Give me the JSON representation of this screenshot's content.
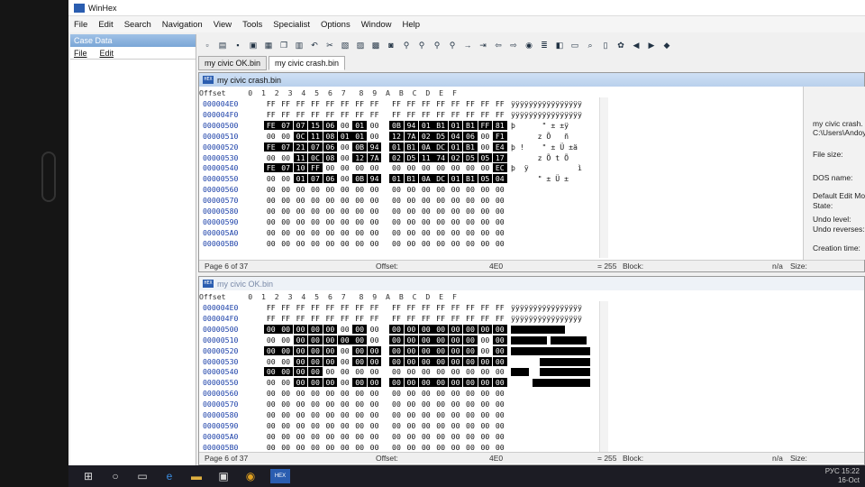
{
  "app": {
    "title": "WinHex"
  },
  "menu": [
    "File",
    "Edit",
    "Search",
    "Navigation",
    "View",
    "Tools",
    "Specialist",
    "Options",
    "Window",
    "Help"
  ],
  "left_pane": {
    "title": "Case Data",
    "menu": [
      "File",
      "Edit"
    ]
  },
  "tabs": [
    {
      "label": "my civic OK.bin"
    },
    {
      "label": "my civic crash.bin"
    }
  ],
  "hex_header": "Offset     0  1  2  3  4  5  6  7   8  9  A  B  C  D  E  F",
  "editor_top": {
    "title": "my civic crash.bin",
    "offsets": [
      "000004E0",
      "000004F0",
      "00000500",
      "00000510",
      "00000520",
      "00000530",
      "00000540",
      "00000550",
      "00000560",
      "00000570",
      "00000580",
      "00000590",
      "000005A0",
      "000005B0"
    ],
    "rows": [
      [
        "FF",
        "FF",
        "FF",
        "FF",
        "FF",
        "FF",
        "FF",
        "FF",
        "FF",
        "FF",
        "FF",
        "FF",
        "FF",
        "FF",
        "FF",
        "FF"
      ],
      [
        "FF",
        "FF",
        "FF",
        "FF",
        "FF",
        "FF",
        "FF",
        "FF",
        "FF",
        "FF",
        "FF",
        "FF",
        "FF",
        "FF",
        "FF",
        "FF"
      ],
      [
        "FE",
        "07",
        "07",
        "15",
        "06",
        "00",
        "01",
        "00",
        "0B",
        "94",
        "01",
        "B1",
        "01",
        "B1",
        "FF",
        "81"
      ],
      [
        "00",
        "00",
        "0C",
        "11",
        "08",
        "01",
        "01",
        "00",
        "12",
        "7A",
        "02",
        "D5",
        "04",
        "06",
        "00",
        "F1"
      ],
      [
        "FE",
        "07",
        "21",
        "07",
        "06",
        "00",
        "0B",
        "94",
        "01",
        "B1",
        "0A",
        "DC",
        "01",
        "B1",
        "00",
        "E4"
      ],
      [
        "00",
        "00",
        "11",
        "0C",
        "08",
        "00",
        "12",
        "7A",
        "02",
        "D5",
        "11",
        "74",
        "02",
        "D5",
        "05",
        "17"
      ],
      [
        "FE",
        "07",
        "10",
        "FF",
        "00",
        "00",
        "00",
        "00",
        "00",
        "00",
        "00",
        "00",
        "00",
        "00",
        "00",
        "EC"
      ],
      [
        "00",
        "00",
        "01",
        "07",
        "06",
        "00",
        "0B",
        "94",
        "01",
        "B1",
        "0A",
        "DC",
        "01",
        "B1",
        "05",
        "04"
      ],
      [
        "00",
        "00",
        "00",
        "00",
        "00",
        "00",
        "00",
        "00",
        "00",
        "00",
        "00",
        "00",
        "00",
        "00",
        "00",
        "00"
      ],
      [
        "00",
        "00",
        "00",
        "00",
        "00",
        "00",
        "00",
        "00",
        "00",
        "00",
        "00",
        "00",
        "00",
        "00",
        "00",
        "00"
      ],
      [
        "00",
        "00",
        "00",
        "00",
        "00",
        "00",
        "00",
        "00",
        "00",
        "00",
        "00",
        "00",
        "00",
        "00",
        "00",
        "00"
      ],
      [
        "00",
        "00",
        "00",
        "00",
        "00",
        "00",
        "00",
        "00",
        "00",
        "00",
        "00",
        "00",
        "00",
        "00",
        "00",
        "00"
      ],
      [
        "00",
        "00",
        "00",
        "00",
        "00",
        "00",
        "00",
        "00",
        "00",
        "00",
        "00",
        "00",
        "00",
        "00",
        "00",
        "00"
      ],
      [
        "00",
        "00",
        "00",
        "00",
        "00",
        "00",
        "00",
        "00",
        "00",
        "00",
        "00",
        "00",
        "00",
        "00",
        "00",
        "00"
      ]
    ],
    "text_rows": [
      "ÿÿÿÿÿÿÿÿÿÿÿÿÿÿÿÿ",
      "ÿÿÿÿÿÿÿÿÿÿÿÿÿÿÿÿ",
      "þ      \" ± ±ÿ",
      "      z Õ   ñ",
      "þ !    \" ± Ü ±ä",
      "      z Õ t Õ",
      "þ  ÿ           ì",
      "      \" ± Ü ±",
      "",
      " ",
      " ",
      " ",
      " ",
      " "
    ],
    "status": {
      "page": "Page 6 of 37",
      "offset_label": "Offset:",
      "offset_value": "4E0",
      "value": "= 255",
      "block_label": "Block:",
      "block_value": "n/a",
      "size_label": "Size:"
    }
  },
  "info_panel": {
    "filename": "my civic crash.",
    "path": "C:\\Users\\Andoy",
    "file_size": "File size:",
    "dos_name": "DOS name:",
    "default_edit": "Default Edit Mod",
    "state": "State:",
    "undo_level": "Undo level:",
    "undo_reverses": "Undo reverses:",
    "creation_time": "Creation time:"
  },
  "editor_bottom": {
    "title": "my civic OK.bin",
    "offsets": [
      "000004E0",
      "000004F0",
      "00000500",
      "00000510",
      "00000520",
      "00000530",
      "00000540",
      "00000550",
      "00000560",
      "00000570",
      "00000580",
      "00000590",
      "000005A0",
      "000005B0"
    ],
    "rows": [
      [
        "FF",
        "FF",
        "FF",
        "FF",
        "FF",
        "FF",
        "FF",
        "FF",
        "FF",
        "FF",
        "FF",
        "FF",
        "FF",
        "FF",
        "FF",
        "FF"
      ],
      [
        "FF",
        "FF",
        "FF",
        "FF",
        "FF",
        "FF",
        "FF",
        "FF",
        "FF",
        "FF",
        "FF",
        "FF",
        "FF",
        "FF",
        "FF",
        "FF"
      ],
      [
        "00",
        "00",
        "00",
        "00",
        "00",
        "00",
        "00",
        "00",
        "00",
        "00",
        "00",
        "00",
        "00",
        "00",
        "00",
        "00"
      ],
      [
        "00",
        "00",
        "00",
        "00",
        "00",
        "00",
        "00",
        "00",
        "00",
        "00",
        "00",
        "00",
        "00",
        "00",
        "00",
        "00"
      ],
      [
        "00",
        "00",
        "00",
        "00",
        "00",
        "00",
        "00",
        "00",
        "00",
        "00",
        "00",
        "00",
        "00",
        "00",
        "00",
        "00"
      ],
      [
        "00",
        "00",
        "00",
        "00",
        "00",
        "00",
        "00",
        "00",
        "00",
        "00",
        "00",
        "00",
        "00",
        "00",
        "00",
        "00"
      ],
      [
        "00",
        "00",
        "00",
        "00",
        "00",
        "00",
        "00",
        "00",
        "00",
        "00",
        "00",
        "00",
        "00",
        "00",
        "00",
        "00"
      ],
      [
        "00",
        "00",
        "00",
        "00",
        "00",
        "00",
        "00",
        "00",
        "00",
        "00",
        "00",
        "00",
        "00",
        "00",
        "00",
        "00"
      ],
      [
        "00",
        "00",
        "00",
        "00",
        "00",
        "00",
        "00",
        "00",
        "00",
        "00",
        "00",
        "00",
        "00",
        "00",
        "00",
        "00"
      ],
      [
        "00",
        "00",
        "00",
        "00",
        "00",
        "00",
        "00",
        "00",
        "00",
        "00",
        "00",
        "00",
        "00",
        "00",
        "00",
        "00"
      ],
      [
        "00",
        "00",
        "00",
        "00",
        "00",
        "00",
        "00",
        "00",
        "00",
        "00",
        "00",
        "00",
        "00",
        "00",
        "00",
        "00"
      ],
      [
        "00",
        "00",
        "00",
        "00",
        "00",
        "00",
        "00",
        "00",
        "00",
        "00",
        "00",
        "00",
        "00",
        "00",
        "00",
        "00"
      ],
      [
        "00",
        "00",
        "00",
        "00",
        "00",
        "00",
        "00",
        "00",
        "00",
        "00",
        "00",
        "00",
        "00",
        "00",
        "00",
        "00"
      ],
      [
        "00",
        "00",
        "00",
        "00",
        "00",
        "00",
        "00",
        "00",
        "00",
        "00",
        "00",
        "00",
        "00",
        "00",
        "00",
        "00"
      ]
    ],
    "text_rows": [
      "ÿÿÿÿÿÿÿÿÿÿÿÿÿÿÿÿ",
      "ÿÿÿÿÿÿÿÿÿÿÿÿÿÿÿÿ"
    ],
    "status": {
      "page": "Page 6 of 37",
      "offset_label": "Offset:",
      "offset_value": "4E0",
      "value": "= 255",
      "block_label": "Block:",
      "block_value": "n/a",
      "size_label": "Size:"
    }
  },
  "taskbar": {
    "lang": "РУС",
    "time": "15:22",
    "date": "16-Oct"
  }
}
